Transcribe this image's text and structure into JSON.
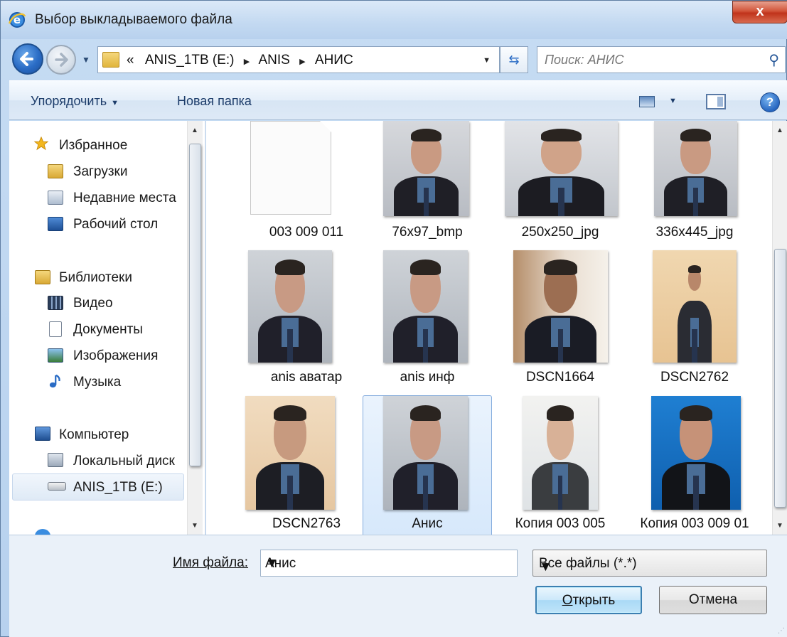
{
  "window": {
    "title": "Выбор выкладываемого файла",
    "close_label": "x"
  },
  "navigation": {
    "crumb_prefix": "«",
    "crumbs": [
      "ANIS_1TB (E:)",
      "ANIS",
      "АНИС"
    ],
    "refresh_icon": "refresh-icon",
    "search_placeholder": "Поиск: АНИС"
  },
  "toolbar": {
    "organize_label": "Упорядочить",
    "new_folder_label": "Новая папка",
    "help_label": "?"
  },
  "sidebar": {
    "groups": [
      {
        "label": "Избранное",
        "icon": "star-icon",
        "items": [
          {
            "label": "Загрузки",
            "icon": "downloads-folder-icon"
          },
          {
            "label": "Недавние места",
            "icon": "recent-places-icon"
          },
          {
            "label": "Рабочий стол",
            "icon": "desktop-icon"
          }
        ]
      },
      {
        "label": "Библиотеки",
        "icon": "libraries-icon",
        "items": [
          {
            "label": "Видео",
            "icon": "video-icon"
          },
          {
            "label": "Документы",
            "icon": "documents-icon"
          },
          {
            "label": "Изображения",
            "icon": "pictures-icon"
          },
          {
            "label": "Музыка",
            "icon": "music-icon"
          }
        ]
      },
      {
        "label": "Компьютер",
        "icon": "computer-icon",
        "items": [
          {
            "label": "Локальный диск",
            "icon": "local-disk-icon"
          },
          {
            "label": "ANIS_1TB (E:)",
            "icon": "drive-icon",
            "selected": true
          }
        ]
      }
    ]
  },
  "files": [
    {
      "name": "003 009 011",
      "kind": "blank"
    },
    {
      "name": "76x97_bmp",
      "kind": "photo"
    },
    {
      "name": "250x250_jpg",
      "kind": "photo"
    },
    {
      "name": "336x445_jpg",
      "kind": "photo"
    },
    {
      "name": "anis аватар",
      "kind": "photo"
    },
    {
      "name": "anis инф",
      "kind": "photo"
    },
    {
      "name": "DSCN1664",
      "kind": "photo"
    },
    {
      "name": "DSCN2762",
      "kind": "photo"
    },
    {
      "name": "DSCN2763",
      "kind": "photo"
    },
    {
      "name": "Анис",
      "kind": "photo",
      "selected": true
    },
    {
      "name": "Копия 003 005",
      "kind": "photo"
    },
    {
      "name": "Копия 003 009 01",
      "kind": "photo"
    }
  ],
  "footer": {
    "filename_label": "Имя файла:",
    "filename_value": "Анис",
    "filter_value": "Все файлы (*.*)",
    "open_label_underlined": "О",
    "open_label_rest": "ткрыть",
    "cancel_label": "Отмена"
  }
}
